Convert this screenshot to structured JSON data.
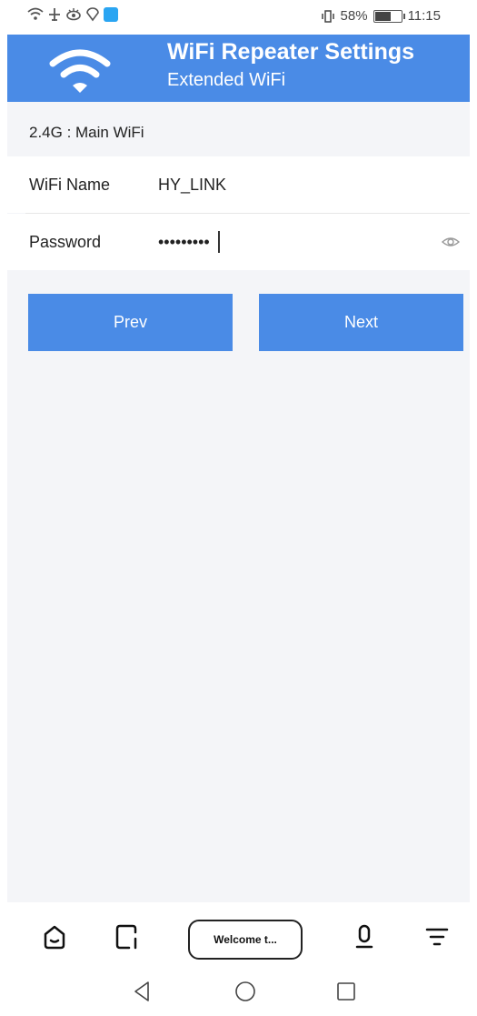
{
  "status_bar": {
    "battery_percent": "58%",
    "battery_level": 0.58,
    "time": "11:15",
    "left_icons": [
      "wifi-icon",
      "airplane-icon",
      "eye-icon",
      "location-icon",
      "app-notification-icon"
    ],
    "right_icons": [
      "vibrate-icon",
      "battery-icon"
    ]
  },
  "header": {
    "title": "WiFi Repeater Settings",
    "subtitle": "Extended WiFi",
    "logo_icon": "wifi-icon",
    "background_color": "#4a8be6"
  },
  "section": {
    "title": "2.4G : Main WiFi"
  },
  "form": {
    "wifi_name_label": "WiFi Name",
    "wifi_name_value": "HY_LINK",
    "password_label": "Password",
    "password_value": "•••••••••",
    "password_toggle_icon": "eye-icon"
  },
  "buttons": {
    "prev_label": "Prev",
    "next_label": "Next",
    "color": "#4a8be6"
  },
  "browser_toolbar": {
    "address_text": "Welcome t...",
    "icons": [
      "home-icon",
      "tabs-icon",
      "mic-icon",
      "menu-icon"
    ]
  },
  "system_nav": {
    "icons": [
      "back-icon",
      "home-circle-icon",
      "recent-apps-icon"
    ]
  }
}
